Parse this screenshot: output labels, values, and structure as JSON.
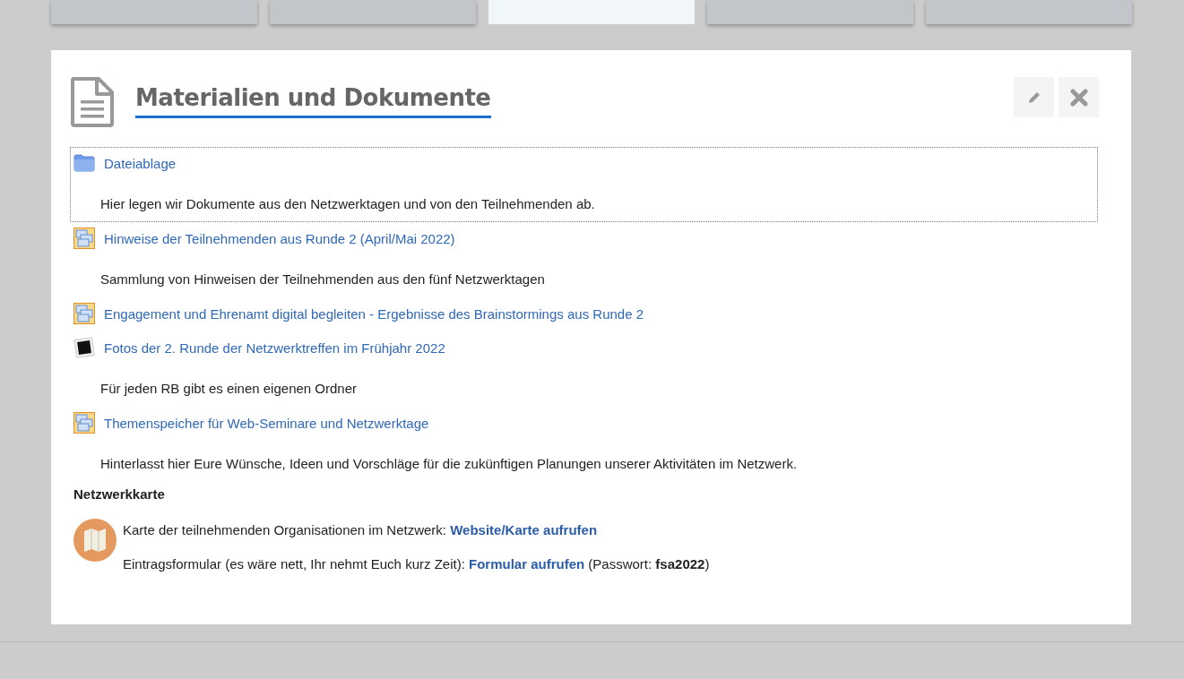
{
  "tabs": [
    {
      "selected": false
    },
    {
      "selected": false
    },
    {
      "selected": true
    },
    {
      "selected": false
    },
    {
      "selected": false
    }
  ],
  "card": {
    "title": "Materialien und Dokumente"
  },
  "items": [
    {
      "kind": "folder",
      "title": "Dateiablage",
      "description": "Hier legen wir Dokumente aus den Netzwerktagen und von den Teilnehmenden ab.",
      "focused": true
    },
    {
      "kind": "page",
      "title": "Hinweise der Teilnehmenden aus Runde 2 (April/Mai 2022)",
      "description": "Sammlung von Hinweisen der Teilnehmenden aus den fünf Netzwerktagen",
      "focused": false
    },
    {
      "kind": "page",
      "title": "Engagement und Ehrenamt digital begleiten - Ergebnisse des Brainstormings aus Runde 2",
      "focused": false
    },
    {
      "kind": "photo",
      "title": "Fotos der 2. Runde der Netzwerktreffen im Frühjahr 2022",
      "description": "Für jeden RB gibt es einen eigenen Ordner",
      "focused": false
    },
    {
      "kind": "page",
      "title": "Themenspeicher für Web-Seminare und Netzwerktage",
      "description": "Hinterlasst hier Eure Wünsche, Ideen und Vorschläge für die zukünftigen Planungen unserer Aktivitäten im Netzwerk.",
      "focused": false
    }
  ],
  "map_section": {
    "heading": "Netzwerkkarte",
    "lines": [
      {
        "text": "Karte der teilnehmenden Organisationen im Netzwerk: ",
        "link": "Website/Karte aufrufen"
      },
      {
        "text": "Eintragsformular (es wäre nett, Ihr nehmt Euch kurz Zeit): ",
        "link": "Formular aufrufen",
        "after": " (Passwort: **fsa2022**)"
      }
    ]
  }
}
